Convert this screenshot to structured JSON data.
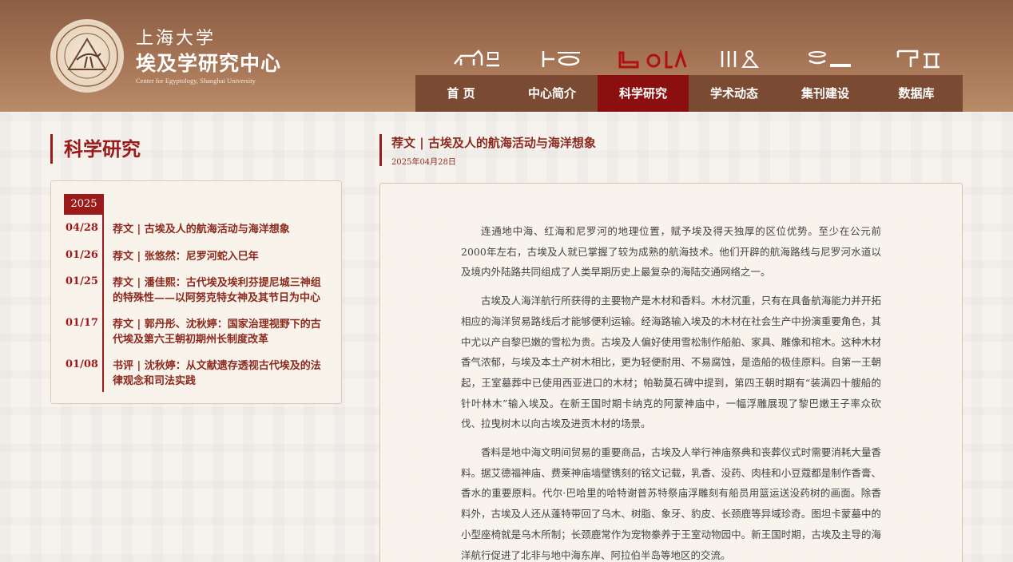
{
  "header": {
    "title_line1": "上海大学",
    "title_line2": "埃及学研究中心",
    "title_en": "Center for Egyptology, Shanghai University",
    "colors": {
      "header_bg": "#a67556",
      "nav_bg": "#7a4a33",
      "active": "#8b0f0f"
    }
  },
  "nav": {
    "items": [
      {
        "label": "首 页"
      },
      {
        "label": "中心简介"
      },
      {
        "label": "科学研究",
        "active": true
      },
      {
        "label": "学术动态"
      },
      {
        "label": "集刊建设"
      },
      {
        "label": "数据库"
      }
    ],
    "glyph_icons": [
      "animal-hieroglyph-icon",
      "snake-hieroglyph-icon",
      "foot-hieroglyph-icon",
      "figure-hieroglyph-icon",
      "boat-hieroglyph-icon",
      "gate-hieroglyph-icon"
    ]
  },
  "sidebar": {
    "section_title": "科学研究",
    "year": "2025",
    "items": [
      {
        "date": "04/28",
        "title": "荐文 | 古埃及人的航海活动与海洋想象"
      },
      {
        "date": "01/26",
        "title": "荐文 | 张悠然：尼罗河蛇入巳年"
      },
      {
        "date": "01/25",
        "title": "荐文 | 潘佳熙：古代埃及埃利芬提尼城三神组的特殊性——以阿努克特女神及其节日为中心"
      },
      {
        "date": "01/17",
        "title": "荐文 | 郭丹彤、沈秋婷：国家治理视野下的古代埃及第六王朝初期州长制度改革"
      },
      {
        "date": "01/08",
        "title": "书评 | 沈秋婷：从文献遗存透视古代埃及的法律观念和司法实践"
      }
    ]
  },
  "article": {
    "title": "荐文 | 古埃及人的航海活动与海洋想象",
    "date": "2025年04月28日",
    "paragraphs": [
      "连通地中海、红海和尼罗河的地理位置，赋予埃及得天独厚的区位优势。至少在公元前2000年左右，古埃及人就已掌握了较为成熟的航海技术。他们开辟的航海路线与尼罗河水道以及境内外陆路共同组成了人类早期历史上最复杂的海陆交通网络之一。",
      "古埃及人海洋航行所获得的主要物产是木材和香料。木材沉重，只有在具备航海能力并开拓相应的海洋贸易路线后才能够便利运输。经海路输入埃及的木材在社会生产中扮演重要角色，其中尤以产自黎巴嫩的雪松为贵。古埃及人偏好使用雪松制作船舶、家具、雕像和棺木。这种木材香气浓郁，与埃及本土产树木相比，更为轻便耐用、不易腐蚀，是造船的极佳原料。自第一王朝起，王室墓葬中已使用西亚进口的木材；帕勒莫石碑中提到，第四王朝时期有“装满四十艘船的针叶林木”输入埃及。在新王国时期卡纳克的阿蒙神庙中，一幅浮雕展现了黎巴嫩王子率众砍伐、拉曳树木以向古埃及进贡木材的场景。",
      "香料是地中海文明间贸易的重要商品，古埃及人举行神庙祭典和丧葬仪式时需要消耗大量香料。据艾德福神庙、费莱神庙墙壁镌刻的铭文记载，乳香、没药、肉桂和小豆蔻都是制作香膏、香水的重要原料。代尔·巴哈里的哈特谢普苏特祭庙浮雕刻有船员用篮运送没药树的画面。除香料外，古埃及人还从蓬特带回了乌木、树脂、象牙、豹皮、长颈鹿等异域珍奇。图坦卡蒙墓中的小型座椅就是乌木所制；长颈鹿常作为宠物豢养于王室动物园中。新王国时期，古埃及主导的海洋航行促进了北非与地中海东岸、阿拉伯半岛等地区的交流。"
    ]
  }
}
